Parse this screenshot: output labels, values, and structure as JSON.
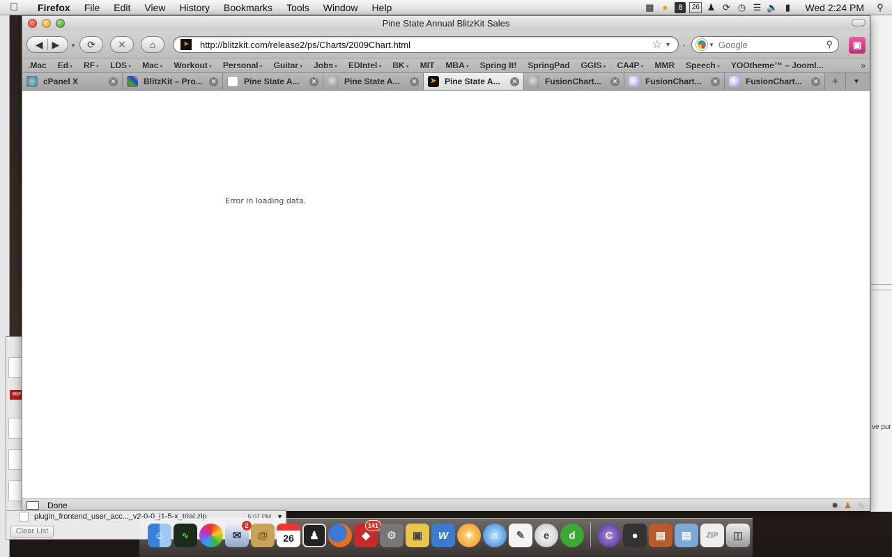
{
  "menubar": {
    "apple": "",
    "items": [
      "Firefox",
      "File",
      "Edit",
      "View",
      "History",
      "Bookmarks",
      "Tools",
      "Window",
      "Help"
    ],
    "calendar_day": "26",
    "clock": "Wed 2:24 PM"
  },
  "window": {
    "title": "Pine State Annual BlitzKit Sales"
  },
  "navbar": {
    "url": "http://blitzkit.com/release2/ps/Charts/2009Chart.html",
    "search_placeholder": "Google"
  },
  "bookmarks": [
    {
      "label": ".Mac",
      "caret": false
    },
    {
      "label": "Ed",
      "caret": true
    },
    {
      "label": "RF",
      "caret": true
    },
    {
      "label": "LDS",
      "caret": true
    },
    {
      "label": "Mac",
      "caret": true
    },
    {
      "label": "Workout",
      "caret": true
    },
    {
      "label": "Personal",
      "caret": true
    },
    {
      "label": "Guitar",
      "caret": true
    },
    {
      "label": "Jobs",
      "caret": true
    },
    {
      "label": "EDIntel",
      "caret": true
    },
    {
      "label": "BK",
      "caret": true
    },
    {
      "label": "MIT",
      "caret": false
    },
    {
      "label": "MBA",
      "caret": true
    },
    {
      "label": "Spring It!",
      "caret": false
    },
    {
      "label": "SpringPad",
      "caret": false
    },
    {
      "label": "GGIS",
      "caret": true
    },
    {
      "label": "CA4P",
      "caret": true
    },
    {
      "label": "MMR",
      "caret": false
    },
    {
      "label": "Speech",
      "caret": true
    },
    {
      "label": "YOOtheme™ – Jooml...",
      "caret": false
    }
  ],
  "tabs": [
    {
      "label": "cPanel X",
      "icon": "cpanel-icon",
      "active": false
    },
    {
      "label": "BlitzKit – Pro...",
      "icon": "blitzkit-icon",
      "active": false
    },
    {
      "label": "Pine State A...",
      "icon": "page-icon",
      "active": false
    },
    {
      "label": "Pine State A...",
      "icon": "globe-icon",
      "active": false
    },
    {
      "label": "Pine State A...",
      "icon": "blitzkit-logo-icon",
      "active": true
    },
    {
      "label": "FusionChart...",
      "icon": "globe-icon",
      "active": false
    },
    {
      "label": "FusionChart...",
      "icon": "fusioncharts-icon",
      "active": false
    },
    {
      "label": "FusionChart...",
      "icon": "fusioncharts-icon",
      "active": false
    }
  ],
  "content": {
    "error_text": "Error in loading data."
  },
  "status": {
    "text": "Done"
  },
  "downloads": {
    "filename": "plugin_frontend_user_acc..._v2-0-0_j1-5-x_trial.zip",
    "time": "5:07 PM",
    "clear_label": "Clear List"
  },
  "desktop": {
    "right_edge_text": "ve pur",
    "pdf_label": "PDF"
  },
  "dock": {
    "mail_badge": "2",
    "calendar_day": "26",
    "app_badge": "141"
  }
}
